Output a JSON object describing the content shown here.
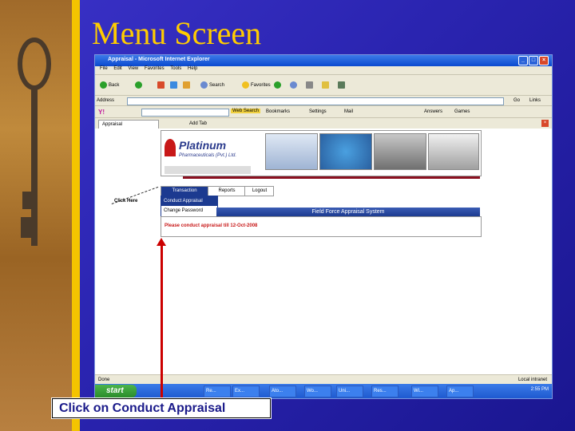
{
  "slide": {
    "title": "Menu Screen",
    "caption": "Click on Conduct Appraisal",
    "click_here_label": "Click Here"
  },
  "ie": {
    "window_title": "Appraisal - Microsoft Internet Explorer",
    "menu": [
      "File",
      "Edit",
      "View",
      "Favorites",
      "Tools",
      "Help"
    ],
    "toolbar": {
      "back": "Back",
      "search": "Search",
      "favorites": "Favorites"
    },
    "address_label": "Address",
    "go_label": "Go",
    "links_label": "Links",
    "search_toolbar": {
      "web_search": "Web Search",
      "bookmarks": "Bookmarks",
      "settings": "Settings",
      "mail": "Mail",
      "answers": "Answers",
      "games": "Games"
    },
    "tabs": [
      "Appraisal",
      "Add Tab"
    ],
    "status_text": "Done",
    "status_zone": "Local intranet"
  },
  "app": {
    "company": "Platinum",
    "company_sub": "Pharmaceuticals (Pvt.) Ltd.",
    "nav": [
      "Transaction",
      "Reports",
      "Logout"
    ],
    "dropdown": [
      "Conduct Appraisal",
      "Change Password"
    ],
    "system_title": "Field Force Appraisal System",
    "notice": "Please conduct appraisal till 12-Oct-2008"
  },
  "taskbar": {
    "start": "start",
    "tasks": [
      "Re...",
      "Ex...",
      "Ato...",
      "Wo...",
      "Uni...",
      "Res...",
      "Wi...",
      "Ap..."
    ],
    "clock": "2:55 PM"
  },
  "colors": {
    "title": "#ffcc00",
    "background": "#2a24b0",
    "accent_red": "#cc0000"
  }
}
